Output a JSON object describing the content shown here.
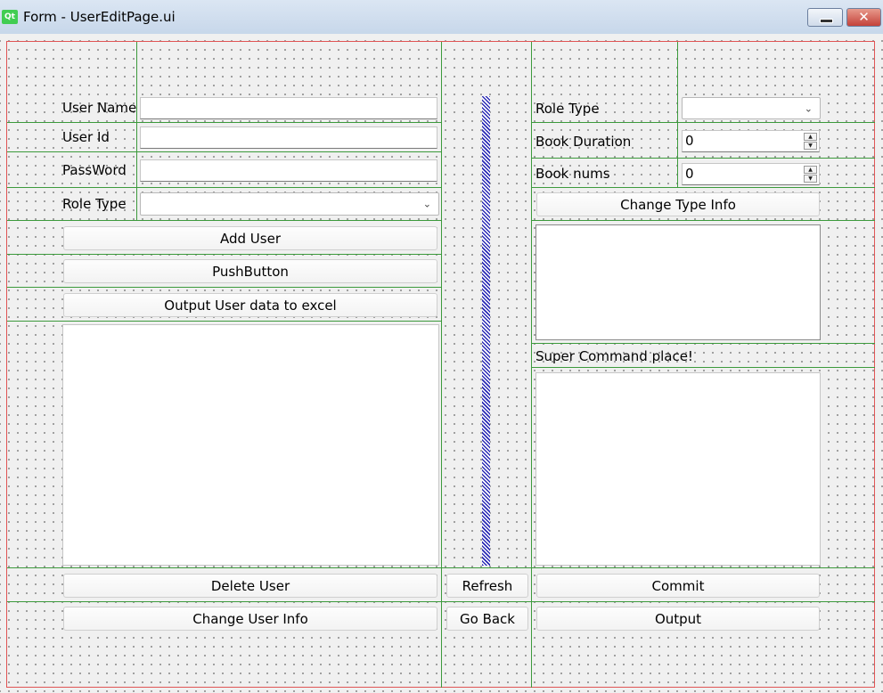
{
  "window": {
    "title": "Form - UserEditPage.ui",
    "app_logo": "Qt",
    "minimize_icon": "minimize-icon",
    "close_glyph": "✕"
  },
  "user_form": {
    "user_name_label": "User Name",
    "user_name_value": "",
    "user_id_label": "User Id",
    "user_id_value": "",
    "password_label": "PassWord",
    "password_value": "",
    "role_type_label": "Role Type",
    "role_type_value": ""
  },
  "left_buttons": {
    "add_user": "Add User",
    "push_button": "PushButton",
    "output_excel": "Output User data to excel",
    "delete_user": "Delete User",
    "change_user_info": "Change User Info"
  },
  "middle_buttons": {
    "refresh": "Refresh",
    "go_back": "Go Back"
  },
  "type_form": {
    "role_type_label": "Role Type",
    "role_type_value": "",
    "book_duration_label": "Book Duration",
    "book_duration_value": "0",
    "book_nums_label": "Book nums",
    "book_nums_value": "0",
    "change_type_info": "Change Type Info",
    "super_command_label": "Super Command place!"
  },
  "right_buttons": {
    "commit": "Commit",
    "output": "Output"
  },
  "colors": {
    "layout_line": "#3c9a3c",
    "frame_border": "#e05555",
    "spacer": "#2b2bb5"
  }
}
